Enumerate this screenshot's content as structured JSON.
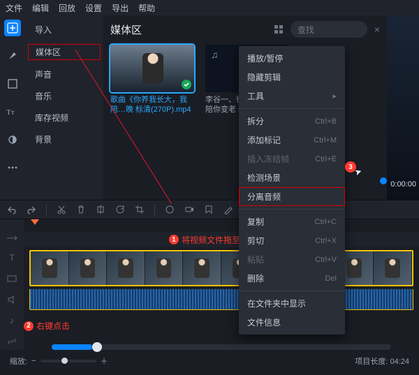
{
  "menubar": [
    "文件",
    "编辑",
    "回放",
    "设置",
    "导出",
    "帮助"
  ],
  "sidepanel": {
    "items": [
      "导入",
      "媒体区",
      "声音",
      "音乐",
      "库存视频",
      "背景"
    ],
    "highlight_index": 1
  },
  "media": {
    "title": "媒体区",
    "search_placeholder": "查找",
    "items": [
      {
        "caption": "歌曲《你养我长大，我陪…晚 标清(270P).mp4",
        "selected": true,
        "type": "video"
      },
      {
        "caption": "李谷一、徐子崴 - 你养…陪你变老 (伴奏).mp…",
        "selected": false,
        "type": "audio"
      }
    ]
  },
  "context_menu": {
    "groups": [
      [
        {
          "label": "播放/暂停",
          "shortcut": ""
        },
        {
          "label": "隐藏剪辑",
          "shortcut": ""
        },
        {
          "label": "工具",
          "shortcut": "",
          "submenu": true
        }
      ],
      [
        {
          "label": "拆分",
          "shortcut": "Ctrl+B"
        },
        {
          "label": "添加标记",
          "shortcut": "Ctrl+M"
        },
        {
          "label": "插入冻结帧",
          "shortcut": "Ctrl+E",
          "disabled": true
        },
        {
          "label": "检测场景",
          "shortcut": ""
        },
        {
          "label": "分离音频",
          "shortcut": "",
          "highlight": true
        }
      ],
      [
        {
          "label": "复制",
          "shortcut": "Ctrl+C"
        },
        {
          "label": "剪切",
          "shortcut": "Ctrl+X"
        },
        {
          "label": "粘贴",
          "shortcut": "Ctrl+V",
          "disabled": true
        },
        {
          "label": "删除",
          "shortcut": "Del"
        }
      ],
      [
        {
          "label": "在文件夹中显示",
          "shortcut": ""
        },
        {
          "label": "文件信息",
          "shortcut": ""
        }
      ]
    ]
  },
  "annotations": {
    "step1": "将视频文件拖至视频轨道",
    "step2": "右键点击",
    "step3_num": "3"
  },
  "preview": {
    "timecode": "0:00:00"
  },
  "footer": {
    "zoom_label": "缩放:",
    "duration_label": "项目长度:",
    "duration_value": "04:24"
  }
}
